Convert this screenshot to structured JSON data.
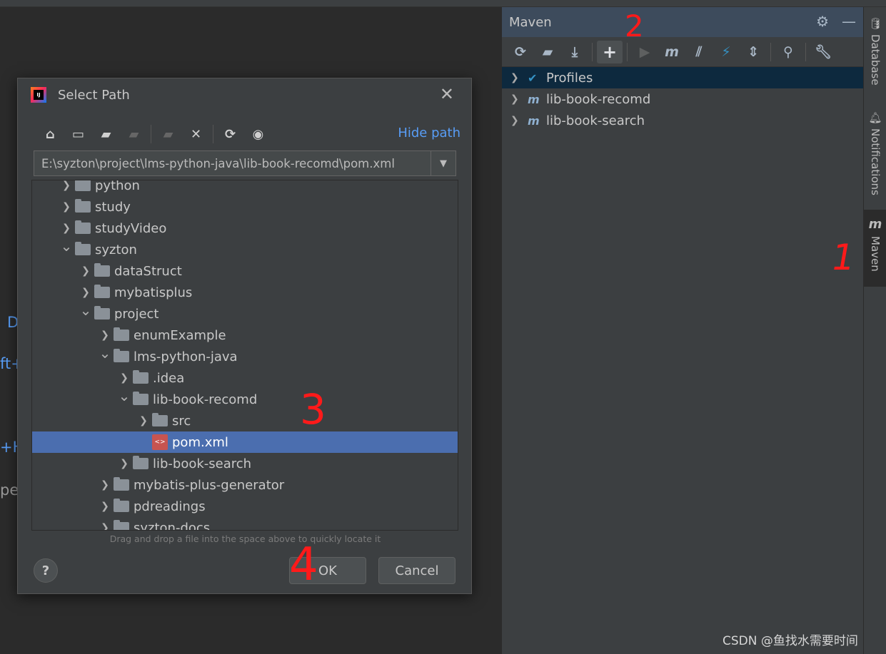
{
  "editor": {
    "frag_d": "D",
    "frag_ft": "ft+",
    "frag_h": "+H",
    "frag_pe": "pe"
  },
  "maven": {
    "title": "Maven",
    "header_icons": [
      "gear-icon",
      "minimize-icon"
    ],
    "toolbar_icons": [
      "reload-icon",
      "generate-sources-icon",
      "download-icon",
      "add-icon",
      "run-icon",
      "execute-goal-icon",
      "toggle-offline-icon",
      "skip-tests-icon",
      "collapse-all-icon",
      "analyze-deps-icon",
      "settings-icon"
    ],
    "tree": [
      {
        "label": "Profiles",
        "selected": true
      },
      {
        "label": "lib-book-recomd",
        "selected": false
      },
      {
        "label": "lib-book-search",
        "selected": false
      }
    ]
  },
  "strip": {
    "database": "Database",
    "notifications": "Notifications",
    "maven_glyph": "m",
    "maven": "Maven"
  },
  "dialog": {
    "title": "Select Path",
    "hide_path": "Hide path",
    "path_value": "E:\\syzton\\project\\lms-python-java\\lib-book-recomd\\pom.xml",
    "tree": [
      {
        "label": "python",
        "level": 0,
        "expanded": false,
        "type": "folder"
      },
      {
        "label": "study",
        "level": 0,
        "expanded": false,
        "type": "folder"
      },
      {
        "label": "studyVideo",
        "level": 0,
        "expanded": false,
        "type": "folder"
      },
      {
        "label": "syzton",
        "level": 0,
        "expanded": true,
        "type": "folder"
      },
      {
        "label": "dataStruct",
        "level": 1,
        "expanded": false,
        "type": "folder"
      },
      {
        "label": "mybatisplus",
        "level": 1,
        "expanded": false,
        "type": "folder"
      },
      {
        "label": "project",
        "level": 1,
        "expanded": true,
        "type": "folder"
      },
      {
        "label": "enumExample",
        "level": 2,
        "expanded": false,
        "type": "folder"
      },
      {
        "label": "lms-python-java",
        "level": 2,
        "expanded": true,
        "type": "folder"
      },
      {
        "label": ".idea",
        "level": 3,
        "expanded": false,
        "type": "folder"
      },
      {
        "label": "lib-book-recomd",
        "level": 3,
        "expanded": true,
        "type": "folder"
      },
      {
        "label": "src",
        "level": 4,
        "expanded": false,
        "type": "folder"
      },
      {
        "label": "pom.xml",
        "level": 4,
        "type": "file",
        "selected": true
      },
      {
        "label": "lib-book-search",
        "level": 3,
        "expanded": false,
        "type": "folder"
      },
      {
        "label": "mybatis-plus-generator",
        "level": 2,
        "expanded": false,
        "type": "folder"
      },
      {
        "label": "pdreadings",
        "level": 2,
        "expanded": false,
        "type": "folder"
      },
      {
        "label": "syzton-docs",
        "level": 2,
        "expanded": false,
        "type": "folder"
      }
    ],
    "hint": "Drag and drop a file into the space above to quickly locate it",
    "ok": "OK",
    "cancel": "Cancel",
    "help": "?"
  },
  "annotations": [
    "2",
    "1",
    "3",
    "4"
  ],
  "watermark": "CSDN @鱼找水需要时间",
  "colors": {
    "selection": "#4b6eaf",
    "maven_selection": "#0d293e",
    "link": "#589df6",
    "annotation": "#ff1a1a"
  }
}
